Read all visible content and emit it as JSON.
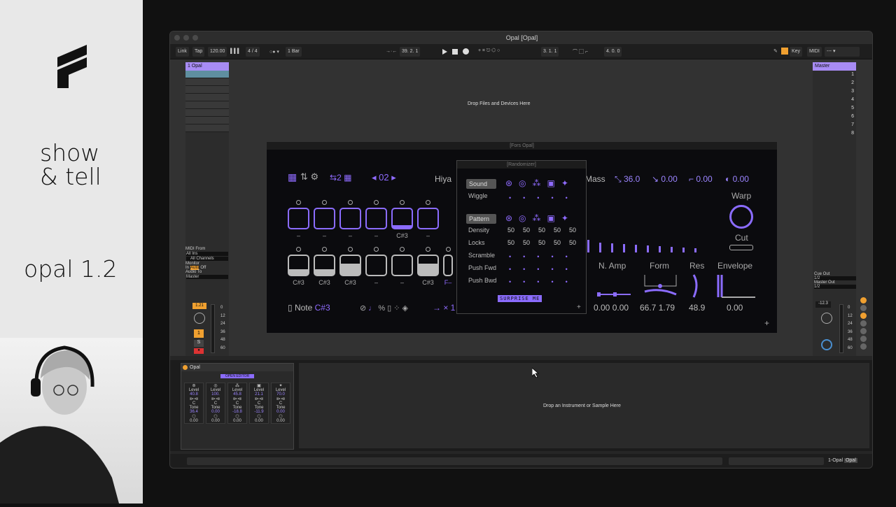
{
  "overlay": {
    "line1": "show",
    "line2": "& tell",
    "version": "opal 1.2"
  },
  "window": {
    "title": "Opal  [Opal]"
  },
  "control_bar": {
    "link": "Link",
    "tap": "Tap",
    "tempo": "120.00",
    "time_sig": "4 / 4",
    "quantize": "1 Bar",
    "position": "39.  2.  1",
    "loop_start": "3.  1.  1",
    "loop_length": "4.  0.  0",
    "key": "Key",
    "midi": "MIDI"
  },
  "tracks": {
    "track1": "1 Opal",
    "master": "Master",
    "master_scene_numbers": [
      "1",
      "2",
      "3",
      "4",
      "5",
      "6",
      "7",
      "8"
    ],
    "drop_files": "Drop Files and Devices Here"
  },
  "io": {
    "midi_from": "MIDI From",
    "all_ins": "All Ins",
    "all_channels": "All Channels",
    "monitor": "Monitor",
    "monitor_opts": [
      "In",
      "Auto",
      "Off"
    ],
    "audio_to": "Audio To",
    "audio_to_value": "Master",
    "cue_out": "Cue Out",
    "cue_value": "1/2",
    "master_out": "Master Out",
    "master_value": "1/2"
  },
  "mixer": {
    "track_vol": "1.21",
    "track_num": "1",
    "solo": "S",
    "arm": "●",
    "master_vol": "-12.3",
    "scale": [
      "0",
      "12",
      "24",
      "36",
      "48",
      "60"
    ]
  },
  "fors": {
    "title": "[Fors Opal]",
    "page": "02",
    "step_count": "2",
    "preset": "Hiya",
    "mass": "Mass",
    "mass_val": "36.0",
    "p2": "0.00",
    "p3": "0.00",
    "p4": "0.00",
    "warp": "Warp",
    "cut": "Cut",
    "n_amp": "N. Amp",
    "form": "Form",
    "res": "Res",
    "envelope": "Envelope",
    "v_namp1": "0.00",
    "v_namp2": "0.00",
    "v_form1": "66.7",
    "v_form2": "1.79",
    "v_res": "48.9",
    "v_env": "0.00",
    "note": "Note",
    "note_val": "C#3",
    "times": "× 1",
    "row1_labels": [
      "–",
      "–",
      "–",
      "–",
      "C#3",
      "–"
    ],
    "row2_labels": [
      "C#3",
      "C#3",
      "C#3",
      "–",
      "–",
      "C#3",
      "F–"
    ]
  },
  "randomizer": {
    "title": "[Randomizer]",
    "sound": "Sound",
    "wiggle": "Wiggle",
    "pattern": "Pattern",
    "density": "Density",
    "locks": "Locks",
    "scramble": "Scramble",
    "push_fwd": "Push Fwd",
    "push_bwd": "Push Bwd",
    "vals": [
      "50",
      "50",
      "50",
      "50",
      "50"
    ],
    "surprise": "SURPRISE ME"
  },
  "opal_device": {
    "name": "Opal",
    "open_editor": "OPEN EDITOR",
    "columns": [
      {
        "level": "40.8",
        "tone": "36.4",
        "bottom": "0.00"
      },
      {
        "level": "100.",
        "tone": "0.00",
        "bottom": "0.00"
      },
      {
        "level": "45.8",
        "tone": "-18.8",
        "bottom": "0.00"
      },
      {
        "level": "21.1",
        "tone": "-11.9",
        "bottom": "0.00"
      },
      {
        "level": "70.0",
        "tone": "0.00",
        "bottom": "0.00"
      }
    ],
    "level_label": "Level",
    "tone_label": "Tone",
    "c_label": "C"
  },
  "drop_instrument": "Drop an Instrument or Sample Here",
  "bottom": {
    "track": "1-Opal",
    "device": "Opal"
  },
  "colors": {
    "accent": "#8b6cff",
    "clip": "#a88cf5",
    "orange": "#f0a030"
  }
}
